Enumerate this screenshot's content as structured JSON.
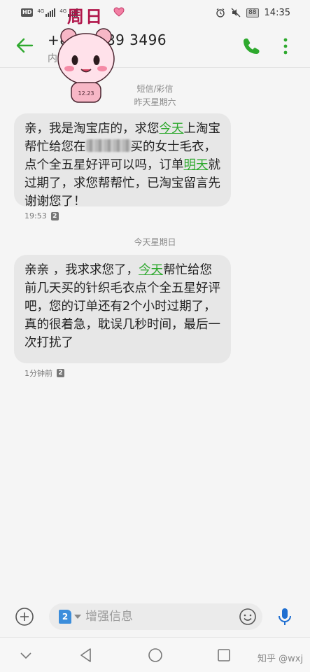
{
  "status_bar": {
    "hd": "HD",
    "network_1": "4G",
    "network_2": "4G",
    "battery": "88",
    "time": "14:35",
    "sticker_text": "周日"
  },
  "header": {
    "contact_number": "+86 1  489 3496",
    "contact_sub": "内        动"
  },
  "thread": [
    {
      "date_label": "短信/彩信",
      "date_sublabel": "昨天星期六",
      "parts": [
        "亲，我是淘宝店的，求您",
        "今天",
        "上淘宝帮忙给您在",
        "买的女士毛衣，点个全五星好评可以吗，订单",
        "明天",
        "就过期了，求您帮帮忙，已淘宝留言先谢谢您了！"
      ],
      "time": "19:53",
      "sim": "2"
    },
    {
      "date_sublabel": "今天星期日",
      "parts": [
        "亲亲 ，我求求您了，",
        "今天",
        "帮忙给您前几天买的针织毛衣点个全五星好评吧，您的订单还有2个小时过期了，真的很着急，耽误几秒时间，最后一次打扰了"
      ],
      "time": "1分钟前",
      "sim": "2"
    }
  ],
  "composer": {
    "sim": "2",
    "placeholder": "增强信息"
  },
  "watermark": "知乎 @wxj",
  "colors": {
    "accent_green": "#2ea92e",
    "bubble_bg": "#e7e7e7",
    "sim_blue": "#3b8ddb"
  }
}
